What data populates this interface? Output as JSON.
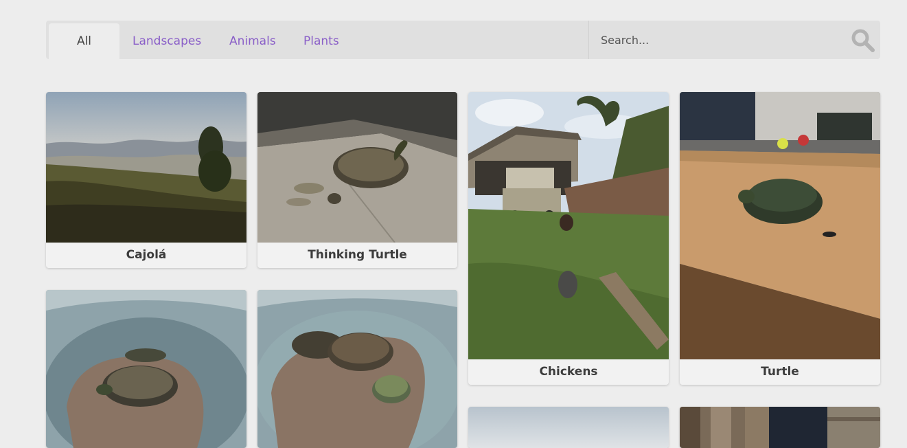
{
  "tabs": [
    {
      "label": "All",
      "active": true
    },
    {
      "label": "Landscapes",
      "active": false
    },
    {
      "label": "Animals",
      "active": false
    },
    {
      "label": "Plants",
      "active": false
    }
  ],
  "search": {
    "placeholder": "Search...",
    "value": ""
  },
  "gallery": [
    {
      "caption": "Cajolá",
      "icon": "landscape-photo"
    },
    {
      "caption": "Thinking Turtle",
      "icon": "turtle-photo"
    },
    {
      "caption": "Chickens",
      "icon": "farm-chickens-photo"
    },
    {
      "caption": "Turtle",
      "icon": "turtle-on-table-photo"
    },
    {
      "caption": "",
      "icon": "turtles-in-tub-photo"
    },
    {
      "caption": "",
      "icon": "turtles-on-rock-photo"
    },
    {
      "caption": "",
      "icon": "sky-photo"
    },
    {
      "caption": "",
      "icon": "doorway-photo"
    }
  ],
  "colors": {
    "accent": "#8a5fc8",
    "background": "#ededed",
    "bar": "#e0e0e0"
  }
}
